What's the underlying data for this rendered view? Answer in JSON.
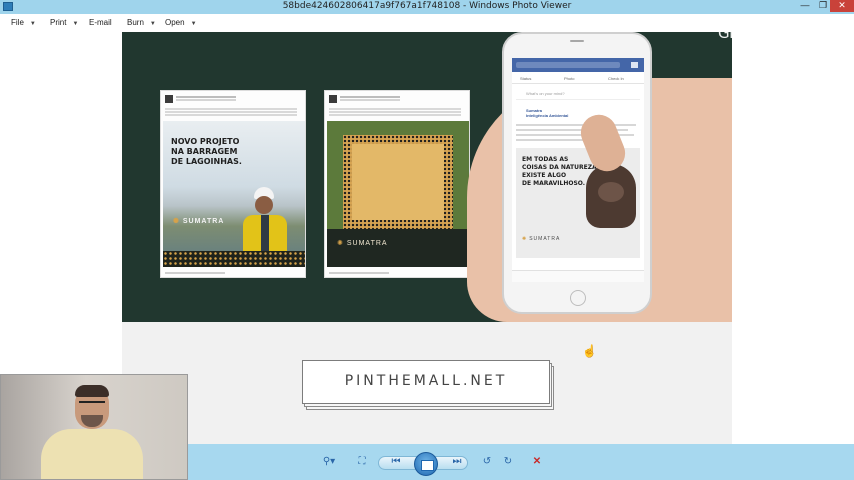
{
  "window": {
    "title": "58bde424602806417a9f767a1f748108 - Windows Photo Viewer",
    "minimize_glyph": "—",
    "maximize_glyph": "❐",
    "close_glyph": "✕"
  },
  "menu": {
    "items": [
      {
        "label": "File",
        "has_dropdown": true
      },
      {
        "label": "Print",
        "has_dropdown": true
      },
      {
        "label": "E-mail",
        "has_dropdown": false
      },
      {
        "label": "Burn",
        "has_dropdown": true
      },
      {
        "label": "Open",
        "has_dropdown": true
      }
    ],
    "dropdown_glyph": "▼"
  },
  "slide": {
    "card1": {
      "headline": "NOVO PROJETO\nNA BARRAGEM\nDE LAGOINHAS.",
      "logo": "SUMATRA"
    },
    "card2": {
      "logo": "SUMATRA"
    },
    "phone": {
      "tabs": [
        "Status",
        "Photo",
        "Check In"
      ],
      "status_prompt": "What's on your mind?",
      "post_name": "Sumatra\nInteligência Ambiental",
      "headline": "EM TODAS AS\nCOISAS DA NATUREZA\nEXISTE ALGO\nDE MARAVILHOSO.",
      "logo": "SUMATRA"
    },
    "footer_logo": "PINTHEMALL.NET"
  },
  "brand": "GEEKMENTOR",
  "toolbar": {
    "zoom_glyph": "⚲▾",
    "actual_size_glyph": "⛶",
    "prev_glyph": "⏮",
    "next_glyph": "⏭",
    "rotate_left_glyph": "↺",
    "rotate_right_glyph": "↻",
    "delete_glyph": "✕"
  },
  "colors": {
    "titlebar": "#9fd4ec",
    "toolbar": "#a7d8ef",
    "slide_green": "#21372f",
    "gold": "#d6a24a",
    "close_red": "#c9423a"
  }
}
